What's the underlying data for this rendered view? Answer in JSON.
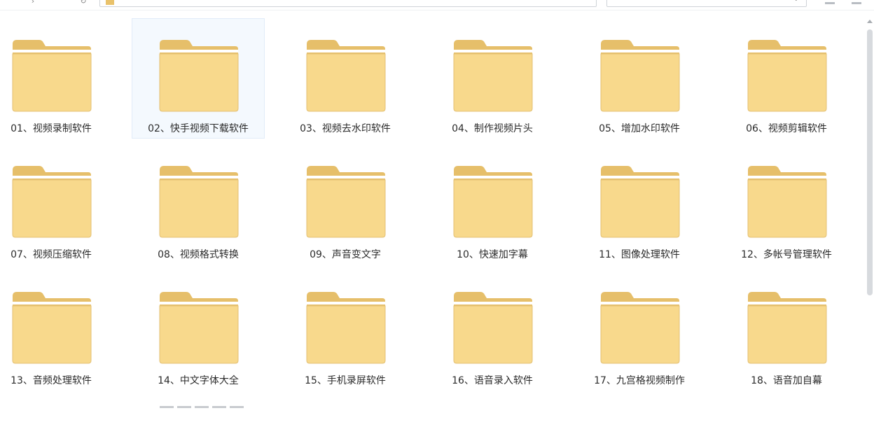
{
  "colors": {
    "folder_back": "#e6bf6a",
    "folder_front": "#f8d98c",
    "folder_stripe": "#ffffff",
    "selection_bg": "#f4f9fe",
    "selection_border": "#e1ecf8"
  },
  "icons": {
    "folder": "folder-icon"
  },
  "folders": [
    {
      "label": "01、视频录制软件",
      "selected": false
    },
    {
      "label": "02、快手视频下载软件",
      "selected": true
    },
    {
      "label": "03、视频去水印软件",
      "selected": false
    },
    {
      "label": "04、制作视频片头",
      "selected": false
    },
    {
      "label": "05、增加水印软件",
      "selected": false
    },
    {
      "label": "06、视频剪辑软件",
      "selected": false
    },
    {
      "label": "07、视频压缩软件",
      "selected": false
    },
    {
      "label": "08、视频格式转换",
      "selected": false
    },
    {
      "label": "09、声音变文字",
      "selected": false
    },
    {
      "label": "10、快速加字幕",
      "selected": false
    },
    {
      "label": "11、图像处理软件",
      "selected": false
    },
    {
      "label": "12、多帐号管理软件",
      "selected": false
    },
    {
      "label": "13、音频处理软件",
      "selected": false
    },
    {
      "label": "14、中文字体大全",
      "selected": false
    },
    {
      "label": "15、手机录屏软件",
      "selected": false
    },
    {
      "label": "16、语音录入软件",
      "selected": false
    },
    {
      "label": "17、九宫格视频制作",
      "selected": false
    },
    {
      "label": "18、语音加自幕",
      "selected": false
    }
  ]
}
